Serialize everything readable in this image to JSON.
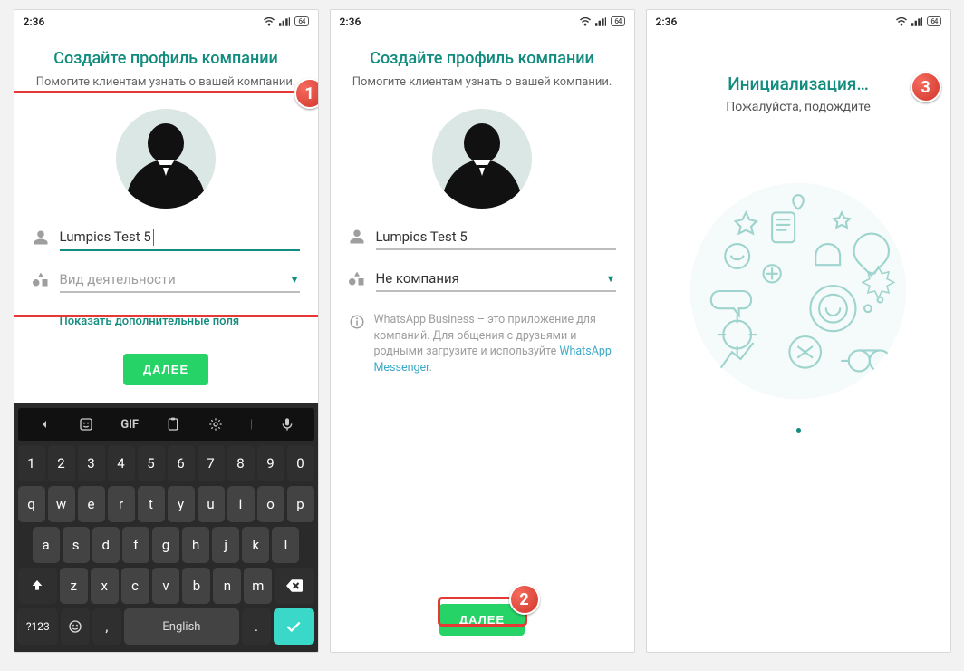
{
  "status": {
    "time": "2:36",
    "battery": "64"
  },
  "screen1": {
    "title": "Создайте профиль компании",
    "subtitle": "Помогите клиентам узнать о вашей компании.",
    "nameValue": "Lumpics Test 5",
    "activityPlaceholder": "Вид деятельности",
    "showMore": "Показать дополнительные поля",
    "nextButton": "ДАЛЕЕ",
    "keyboard": {
      "gif": "GIF",
      "numbers": [
        "1",
        "2",
        "3",
        "4",
        "5",
        "6",
        "7",
        "8",
        "9",
        "0"
      ],
      "row1": [
        "q",
        "w",
        "e",
        "r",
        "t",
        "y",
        "u",
        "i",
        "o",
        "p"
      ],
      "row2": [
        "a",
        "s",
        "d",
        "f",
        "g",
        "h",
        "j",
        "k",
        "l"
      ],
      "row3": [
        "z",
        "x",
        "c",
        "v",
        "b",
        "n",
        "m"
      ],
      "bottom": {
        "symKey": "?123",
        "commaKey": ",",
        "space": "English",
        "dotKey": "."
      }
    }
  },
  "screen2": {
    "title": "Создайте профиль компании",
    "subtitle": "Помогите клиентам узнать о вашей компании.",
    "nameValue": "Lumpics Test 5",
    "activityValue": "Не компания",
    "infoText": "WhatsApp Business – это приложение для компаний. Для общения с друзьями и родными загрузите и используйте ",
    "infoLink": "WhatsApp Messenger",
    "infoTail": ".",
    "nextButton": "ДАЛЕЕ"
  },
  "screen3": {
    "title": "Инициализация…",
    "subtitle": "Пожалуйста, подождите"
  },
  "badges": {
    "b1": "1",
    "b2": "2",
    "b3": "3"
  }
}
